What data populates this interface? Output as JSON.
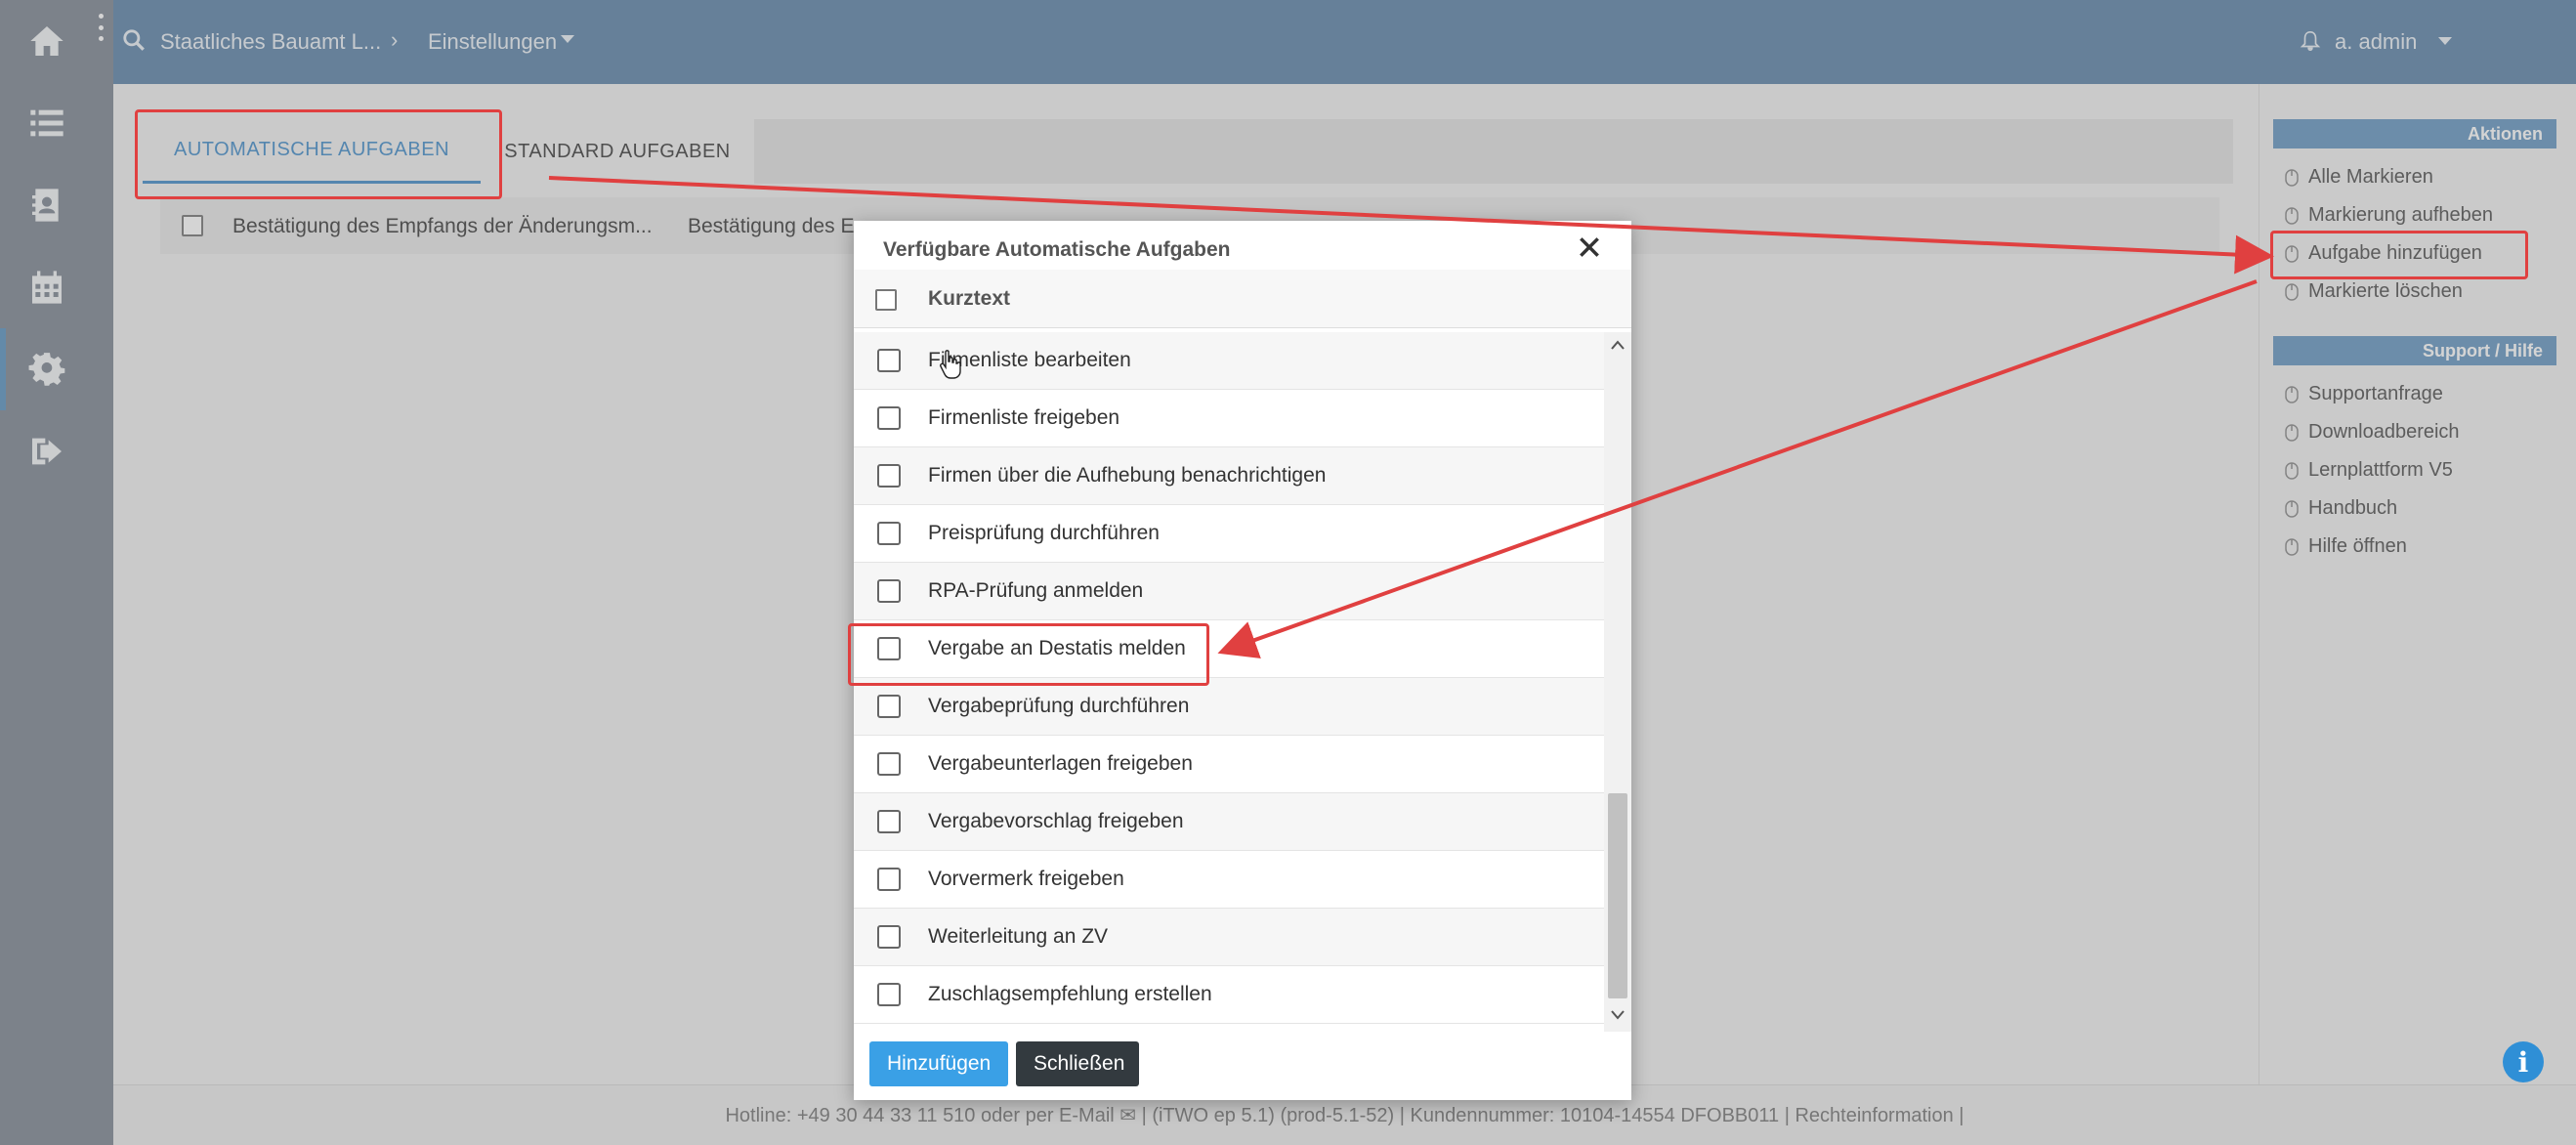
{
  "header": {
    "breadcrumb_1": "Staatliches Bauamt L...",
    "breadcrumb_sep": "›",
    "breadcrumb_2": "Einstellungen",
    "user": "a. admin"
  },
  "tabs": [
    {
      "label": "AUTOMATISCHE AUFGABEN"
    },
    {
      "label": "STANDARD AUFGABEN"
    }
  ],
  "table": {
    "row_col1": "Bestätigung des Empfangs der Änderungsm...",
    "row_col2": "Bestätigung des Em"
  },
  "sidebar": {
    "actions_header": "Aktionen",
    "actions": [
      {
        "label": "Alle Markieren"
      },
      {
        "label": "Markierung aufheben"
      },
      {
        "label": "Aufgabe hinzufügen"
      },
      {
        "label": "Markierte löschen"
      }
    ],
    "support_header": "Support / Hilfe",
    "support": [
      {
        "label": "Supportanfrage"
      },
      {
        "label": "Downloadbereich"
      },
      {
        "label": "Lernplattform V5"
      },
      {
        "label": "Handbuch"
      },
      {
        "label": "Hilfe öffnen"
      }
    ]
  },
  "modal": {
    "title": "Verfügbare Automatische Aufgaben",
    "column_header": "Kurztext",
    "items": [
      {
        "label": "Firmenliste bearbeiten"
      },
      {
        "label": "Firmenliste freigeben"
      },
      {
        "label": "Firmen über die Aufhebung benachrichtigen"
      },
      {
        "label": "Preisprüfung durchführen"
      },
      {
        "label": "RPA-Prüfung anmelden"
      },
      {
        "label": "Vergabe an Destatis melden"
      },
      {
        "label": "Vergabeprüfung durchführen"
      },
      {
        "label": "Vergabeunterlagen freigeben"
      },
      {
        "label": "Vergabevorschlag freigeben"
      },
      {
        "label": "Vorvermerk freigeben"
      },
      {
        "label": "Weiterleitung an ZV"
      },
      {
        "label": "Zuschlagsempfehlung erstellen"
      }
    ],
    "add_button": "Hinzufügen",
    "close_button": "Schließen"
  },
  "footer": {
    "text": "Hotline: +49 30 44 33 11 510 oder per E-Mail ✉ | (iTWO ep 5.1) (prod-5.1-52) | Kundennummer: 10104-14554 DFOBB011 | Rechteinformation |"
  },
  "colors": {
    "header": "#7294b4",
    "accent": "#5b9bd0",
    "highlight": "#e04040",
    "primary_button": "#3aa0e6"
  }
}
